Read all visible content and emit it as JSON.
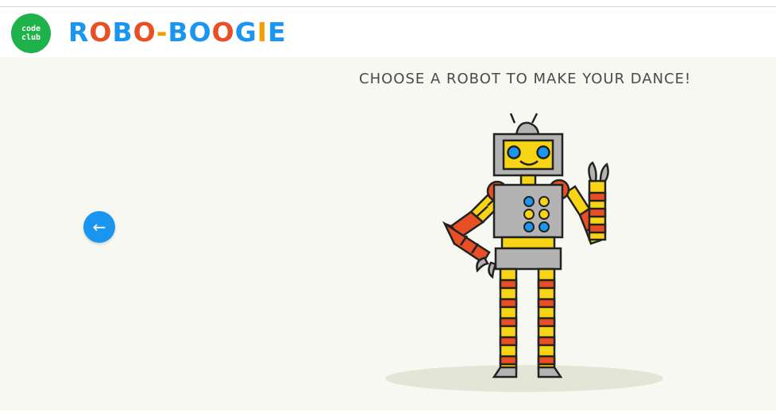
{
  "header": {
    "codeclub_logo": {
      "line1": "code",
      "line2": "club"
    },
    "app_title": "ROBO-BOOGIE",
    "title_colors": [
      "#1a96f0",
      "#e94f25",
      "#1a96f0",
      "#e94f25",
      "#f5a000",
      "#1a96f0",
      "#1a96f0",
      "#e94f25",
      "#1a96f0",
      "#f5a000",
      "#1a96f0"
    ]
  },
  "main": {
    "instruction": "CHOOSE A ROBOT TO MAKE YOUR DANCE!",
    "back_button_icon": "←",
    "robot_icon": "robot-waving-icon"
  },
  "colors": {
    "background": "#f6f8f1",
    "accent_blue": "#1a96f0",
    "codeclub_green": "#1db34a",
    "robot_red": "#e94f25",
    "robot_yellow": "#f7d416",
    "robot_grey": "#b3b3b3"
  }
}
